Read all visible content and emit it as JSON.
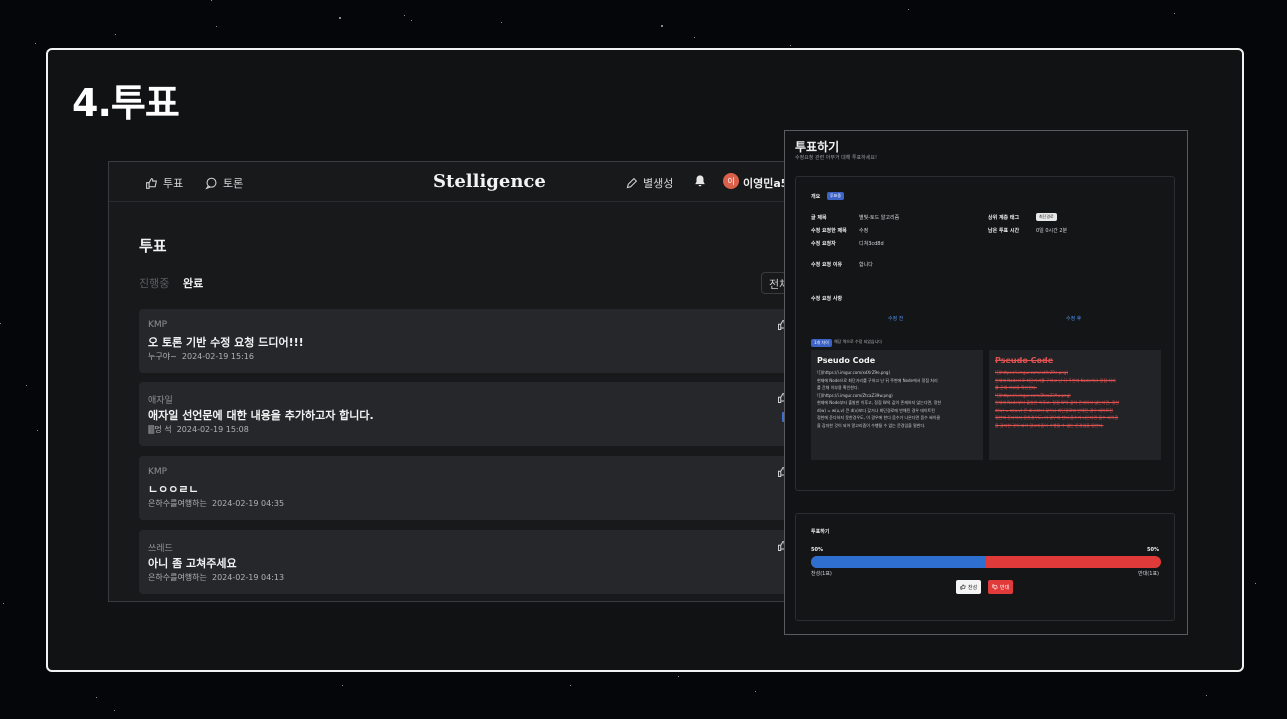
{
  "slide": {
    "title": "4.투표"
  },
  "app": {
    "nav": {
      "vote": "투표",
      "discussion": "토론",
      "brand": "Stelligence",
      "create": "별생성",
      "avatar_initial": "이",
      "user": "이영민a57"
    },
    "page_title": "투표",
    "tabs": {
      "ongoing": "진행중",
      "done": "완료"
    },
    "filter": "전체",
    "cards": [
      {
        "category": "KMP",
        "title": "오 토론 기반 수정 요청 드디어!!!",
        "author": "누구야~",
        "date": "2024-02-19 15:16"
      },
      {
        "category": "애자일",
        "title": "애자일 선언문에 대한 내용을 추가하고자 합니다.",
        "author": "🀫멍 석",
        "date": "2024-02-19 15:08"
      },
      {
        "category": "KMP",
        "title": "ㄴㅇㅇㄹㄴ",
        "author": "은하수를여행하는",
        "date": "2024-02-19 04:35"
      },
      {
        "category": "쓰레드",
        "title": "아니 좀 고쳐주세요",
        "author": "은하수를여행하는",
        "date": "2024-02-19 04:13"
      }
    ]
  },
  "modal": {
    "title": "투표하기",
    "subtitle": "수정요청 관련 아무거 대해 투표하세요!",
    "overview_label": "개요",
    "overview_badge": "투표중",
    "fields": {
      "doc_title_label": "글 제목",
      "doc_title": "별빛-토드 알고리즘",
      "req_title_label": "수정 요청한 제목",
      "req_title": "수정",
      "requester_label": "수정 요청자",
      "requester": "디쳐3cd8d",
      "reason_label": "수정 요청 이유",
      "reason": "합니다",
      "tag_label": "상위 계층 태그",
      "tag": "최단경로",
      "remaining_label": "남은 투표 시간",
      "remaining": "0일 0시간 2분"
    },
    "changes_label": "수정 요청 사항",
    "before_label": "수정 전",
    "after_label": "수정 후",
    "change_badge": "1개 차이",
    "change_note": "해당 역으로 수정 되었습니다",
    "before_code": {
      "heading": "Pseudo Code",
      "lines": [
        "![](https://i.imgur.com/xdXrZ9e.png)",
        "현재에 Node으로 최단거리를 구하고 난 뒤 주변에 Node에서 정점 처리",
        "를 간채 이부용 확인한다.",
        "![](https://i.imgur.com/ZtcaZ39w.png)",
        "현재에 Node부터 출발한 이후고, 정점 W의 값이 존재하지 않는다면, 정한",
        "d(w) = w(u,v) 큰 d(v)보다 갖거나 최단경로에 반해된 경우 데이트된",
        "정한에 준다하지 못한경우도, 이 경우에 한다 음수가 나온다면 음수 싸이클",
        "을 감지한 것이 되어 알고리즘이 수행될 수 없는 문경임을 말한다."
      ]
    },
    "after_code": {
      "heading": "Pseudo Code",
      "lines": [
        "![](https://i.imgur.com/xdXrZ9e.png)",
        "현재에 Node으로 최단거리를 구하고 난 뒤 주변에 Node에서 정점 처리",
        "를 간채 이부용 확인한다.",
        "![](https://i.imgur.com/ZtcaZ39w.png)",
        "현재에 Node부터 출발한 이후고, 정점 W의 값이 존재하지 않는다면, 정한",
        "d(w) = w(u,v) 큰 d(v)보다 갖거나 최단경로에 반해된 경우 데이트된",
        "정한에 준다하지 못한경우도, 이 경우에 한다 음수가 나온다면 음수 싸이클",
        "을 감지한 것이 되어 알고리즘이 수행될 수 없는 문경임을 말한다."
      ]
    },
    "vote": {
      "label": "투표하기",
      "agree_pct": "50%",
      "disagree_pct": "50%",
      "agree_fraction": 0.5,
      "agree_count": "찬성(1표)",
      "disagree_count": "반대(1표)",
      "agree_btn": "찬성",
      "disagree_btn": "반대"
    }
  },
  "colors": {
    "agree": "#2f6fd0",
    "disagree": "#e03a3a",
    "accent_badge": "#3d63c6"
  }
}
